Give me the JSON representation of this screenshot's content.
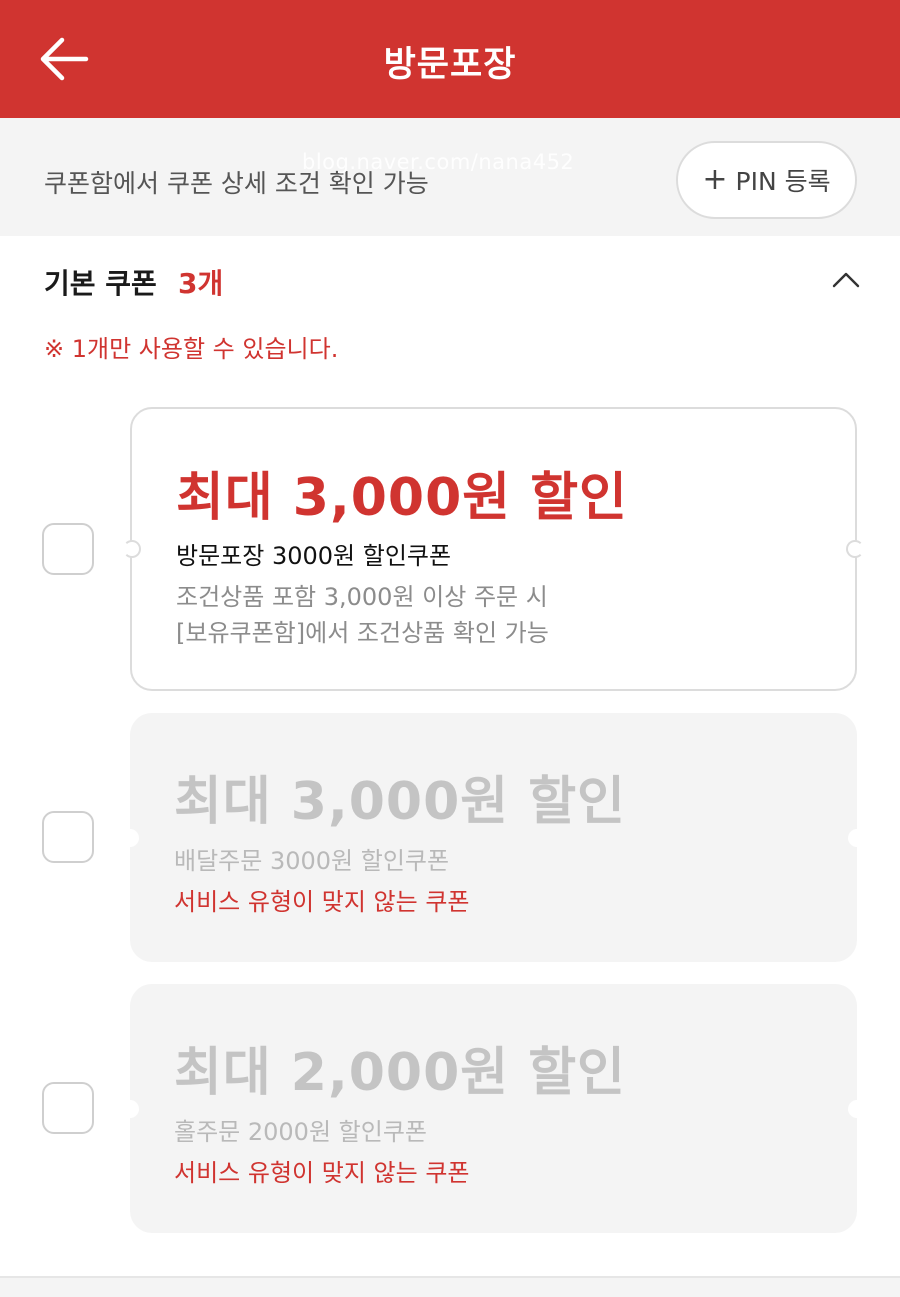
{
  "header": {
    "title": "방문포장",
    "back_icon": "arrow-left-icon",
    "background": "#d03430"
  },
  "info": {
    "text": "쿠폰함에서 쿠폰 상세 조건 확인 가능",
    "watermark": "blog.naver.com/nana452",
    "pin_button_label": "PIN 등록",
    "pin_button_icon": "plus-icon"
  },
  "section": {
    "title": "기본 쿠폰",
    "count": "3개",
    "notice": "※ 1개만 사용할 수 있습니다.",
    "collapse_icon": "chevron-up-icon"
  },
  "coupons": [
    {
      "amount": "최대 3,000원 할인",
      "name": "방문포장 3000원 할인쿠폰",
      "desc1": "조건상품 포함 3,000원 이상 주문 시",
      "desc2": "[보유쿠폰함]에서 조건상품 확인 가능",
      "enabled": true,
      "checked": false
    },
    {
      "amount": "최대 3,000원 할인",
      "name": "배달주문 3000원 할인쿠폰",
      "warning": "서비스 유형이 맞지 않는 쿠폰",
      "enabled": false,
      "checked": false
    },
    {
      "amount": "최대 2,000원 할인",
      "name": "홀주문 2000원 할인쿠폰",
      "warning": "서비스 유형이 맞지 않는 쿠폰",
      "enabled": false,
      "checked": false
    }
  ],
  "colors": {
    "accent": "#d03430",
    "disabled_text": "#c4c4c4",
    "card_disabled_bg": "#f4f4f4"
  }
}
